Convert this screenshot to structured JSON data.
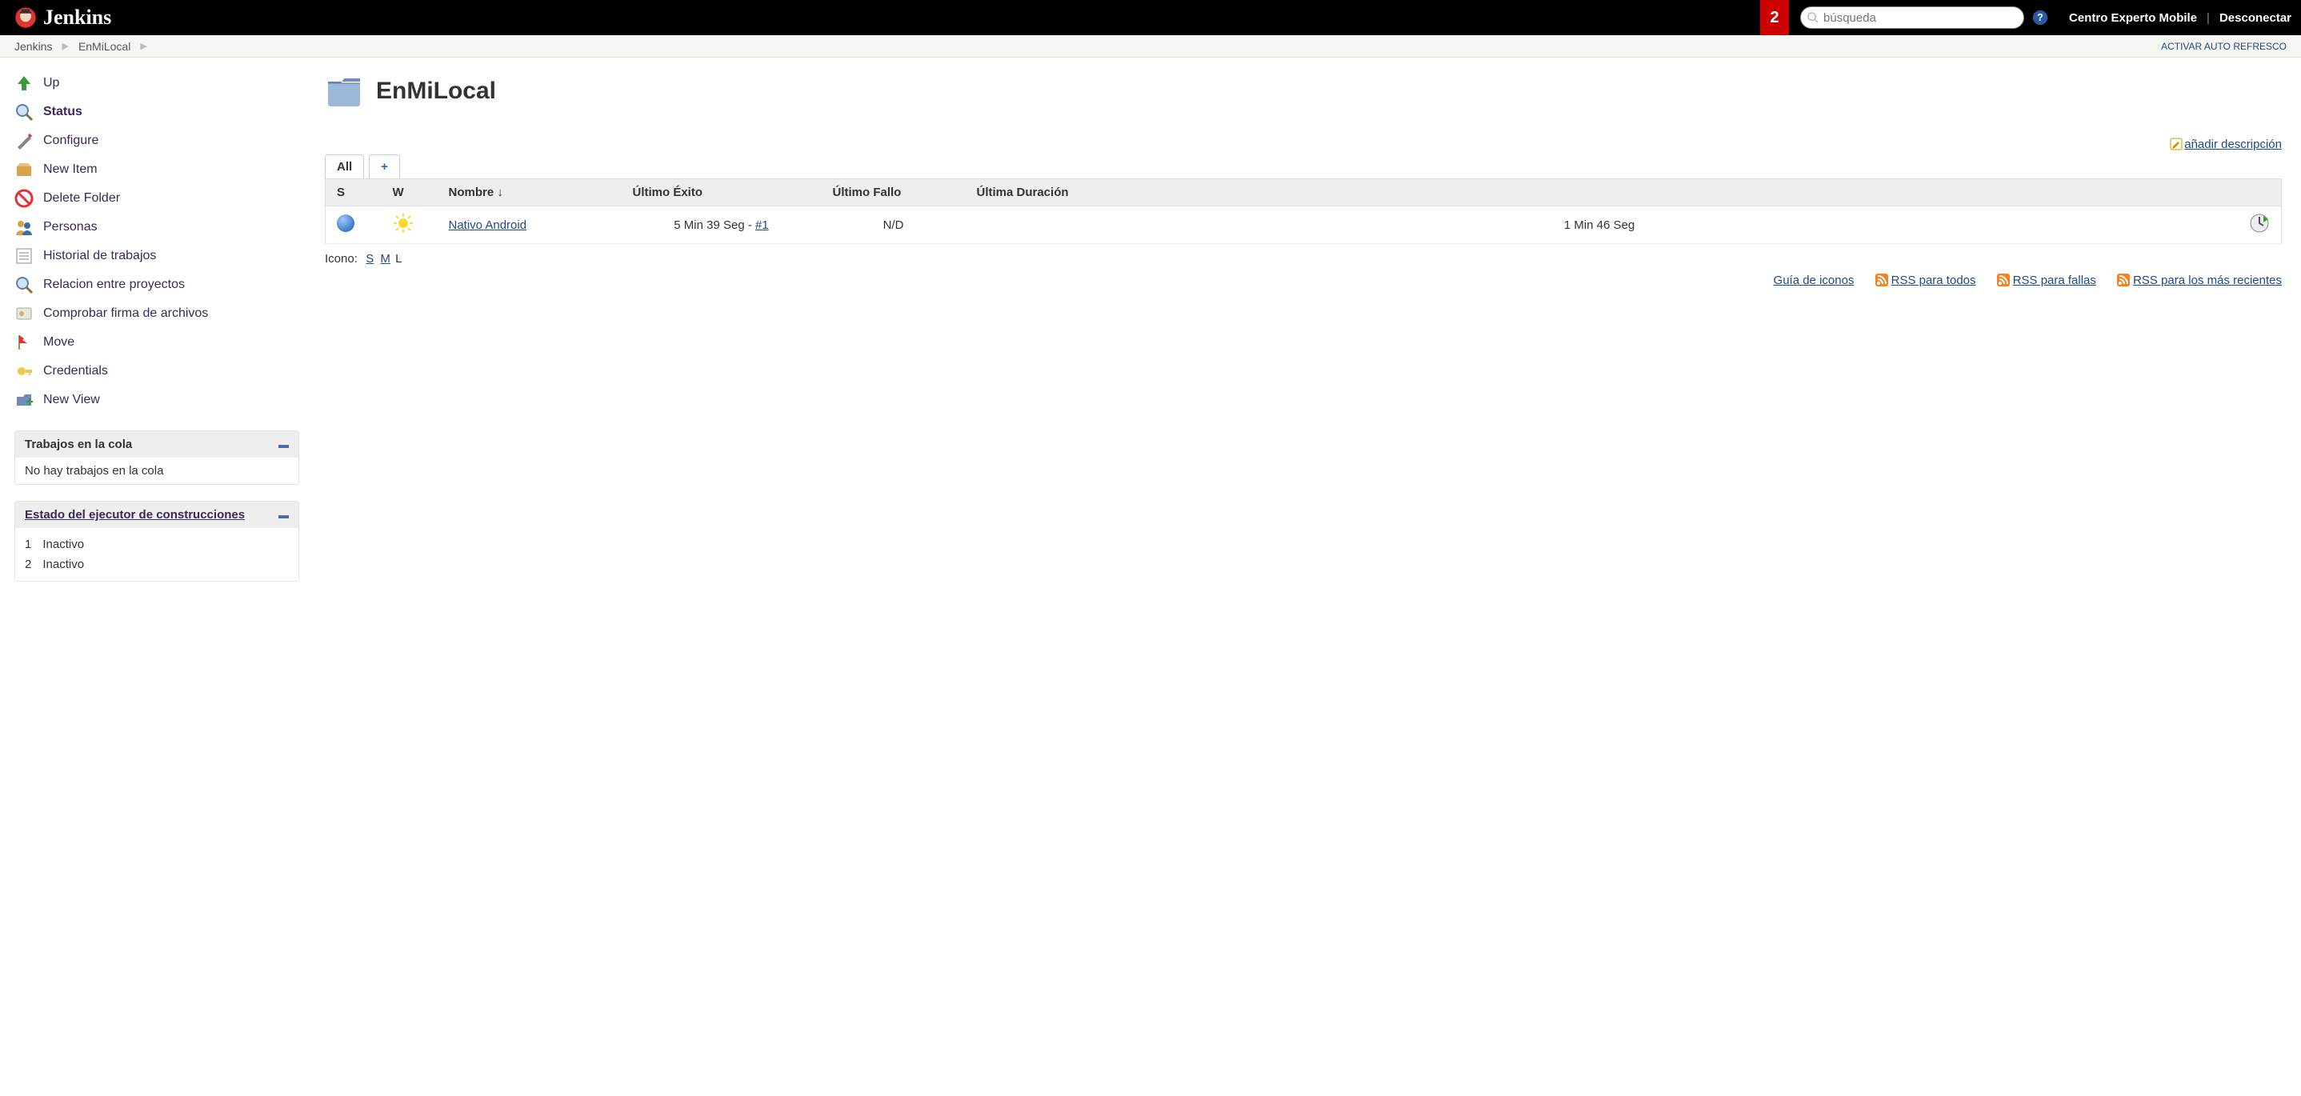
{
  "header": {
    "brand": "Jenkins",
    "notif_count": "2",
    "search_placeholder": "búsqueda",
    "user": "Centro Experto Mobile",
    "logout": "Desconectar"
  },
  "breadcrumbs": {
    "items": [
      "Jenkins",
      "EnMiLocal"
    ],
    "auto_refresh": "ACTIVAR AUTO REFRESCO"
  },
  "sidebar": {
    "tasks": [
      {
        "icon": "up-icon",
        "label": "Up"
      },
      {
        "icon": "search-icon",
        "label": "Status",
        "bold": true
      },
      {
        "icon": "configure-icon",
        "label": "Configure"
      },
      {
        "icon": "new-item-icon",
        "label": "New Item"
      },
      {
        "icon": "delete-icon",
        "label": "Delete Folder"
      },
      {
        "icon": "people-icon",
        "label": "Personas"
      },
      {
        "icon": "history-icon",
        "label": "Historial de trabajos"
      },
      {
        "icon": "relation-icon",
        "label": "Relacion entre proyectos"
      },
      {
        "icon": "fingerprint-icon",
        "label": "Comprobar firma de archivos"
      },
      {
        "icon": "move-icon",
        "label": "Move"
      },
      {
        "icon": "credentials-icon",
        "label": "Credentials"
      },
      {
        "icon": "new-view-icon",
        "label": "New View"
      }
    ],
    "queue": {
      "title": "Trabajos en la cola",
      "empty": "No hay trabajos en la cola"
    },
    "executors": {
      "title": "Estado del ejecutor de construcciones",
      "rows": [
        {
          "n": "1",
          "state": "Inactivo"
        },
        {
          "n": "2",
          "state": "Inactivo"
        }
      ]
    }
  },
  "main": {
    "title": "EnMiLocal",
    "add_description": "añadir descripción",
    "tabs": {
      "all": "All",
      "add": "+"
    },
    "columns": {
      "s": "S",
      "w": "W",
      "name": "Nombre  ↓",
      "last_success": "Último Éxito",
      "last_fail": "Último Fallo",
      "last_duration": "Última Duración"
    },
    "rows": [
      {
        "name": "Nativo Android",
        "last_success_text": "5 Min 39 Seg - ",
        "last_success_build": "#1",
        "last_fail": "N/D",
        "last_duration": "1 Min 46 Seg"
      }
    ],
    "iconsize": {
      "label": "Icono:",
      "s": "S",
      "m": "M",
      "l": "L"
    },
    "legend": "Guía de iconos",
    "rss": {
      "all": "RSS para todos",
      "fail": "RSS para fallas",
      "latest": "RSS para los más recientes"
    }
  }
}
